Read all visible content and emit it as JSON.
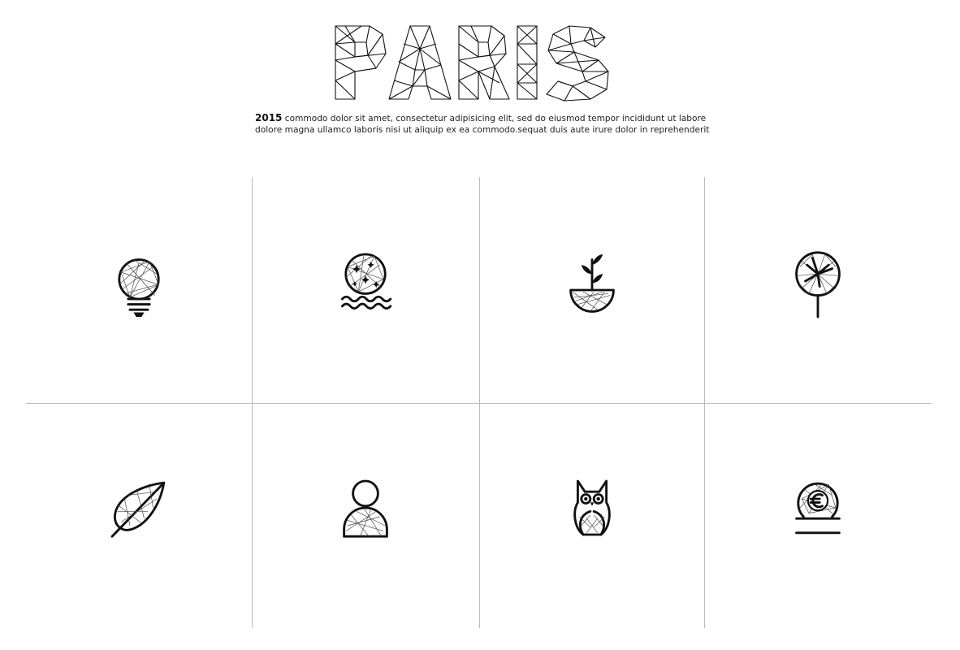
{
  "header": {
    "title": "PARIS",
    "year": "2015",
    "body_line1": "commodo dolor sit amet, consectetur adipisicing elit, sed do eiusmod tempor incididunt ut labore",
    "body_line2": "dolore magna ullamco laboris nisi ut aliquip ex ea commodo.sequat duis aute irure dolor in reprehenderit"
  },
  "icons": [
    {
      "name": "lightbulb-icon"
    },
    {
      "name": "moon-over-water-icon"
    },
    {
      "name": "sprout-in-bowl-icon"
    },
    {
      "name": "tree-icon"
    },
    {
      "name": "leaf-icon"
    },
    {
      "name": "person-icon"
    },
    {
      "name": "owl-icon"
    },
    {
      "name": "euro-coin-icon"
    }
  ],
  "colors": {
    "ink": "#111111",
    "divider": "#bdbdbd",
    "background": "#ffffff"
  }
}
